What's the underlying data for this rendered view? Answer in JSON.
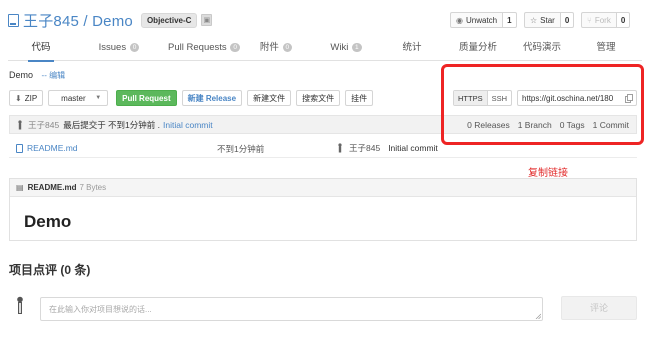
{
  "repo": {
    "title": "王子845 / Demo",
    "language": "Objective-C",
    "lock_icon": "lock-icon"
  },
  "actions": {
    "watch": {
      "label": "Unwatch",
      "count": "1",
      "icon": "eye-icon"
    },
    "star": {
      "label": "Star",
      "count": "0",
      "icon": "star-icon"
    },
    "fork": {
      "label": "Fork",
      "count": "0",
      "icon": "fork-icon"
    }
  },
  "nav": {
    "tabs": [
      {
        "label": "代码",
        "badge": ""
      },
      {
        "label": "Issues",
        "badge": "0"
      },
      {
        "label": "Pull Requests",
        "badge": "0"
      },
      {
        "label": "附件",
        "badge": "0"
      },
      {
        "label": "Wiki",
        "badge": "1"
      },
      {
        "label": "统计",
        "badge": ""
      },
      {
        "label": "质量分析",
        "badge": ""
      },
      {
        "label": "代码演示",
        "badge": ""
      },
      {
        "label": "管理",
        "badge": ""
      }
    ],
    "active_index": 0
  },
  "description": {
    "text": "Demo",
    "edit_link": "-- 编辑"
  },
  "toolbar": {
    "zip": "ZIP",
    "branch": "master",
    "pull_request": "Pull Request",
    "new_release": "新建 Release",
    "new_file": "新建文件",
    "search_file": "搜索文件",
    "plugins": "挂件"
  },
  "clone": {
    "protocols": [
      "HTTPS",
      "SSH"
    ],
    "active_protocol": "HTTPS",
    "url": "https://git.oschina.net/180",
    "copy_icon": "copy-icon"
  },
  "commit": {
    "user": "王子845",
    "text": "最后提交于 不到1分钟前 .",
    "message": "Initial commit"
  },
  "stats": {
    "releases": "0 Releases",
    "branches": "1 Branch",
    "tags": "0 Tags",
    "commits": "1 Commit"
  },
  "files": [
    {
      "name": "README.md",
      "time": "不到1分钟前",
      "author": "王子845",
      "message": "Initial commit"
    }
  ],
  "annotation": "复制链接",
  "colors": {
    "link": "#4a86c5",
    "primary_green": "#5cb85c",
    "annotation_red": "#ee2424"
  },
  "readme": {
    "filename": "README.md",
    "size": "7 Bytes",
    "heading": "Demo"
  },
  "comments": {
    "title": "项目点评 (0 条)",
    "placeholder": "在此输入你对项目想说的话...",
    "submit": "评论"
  }
}
